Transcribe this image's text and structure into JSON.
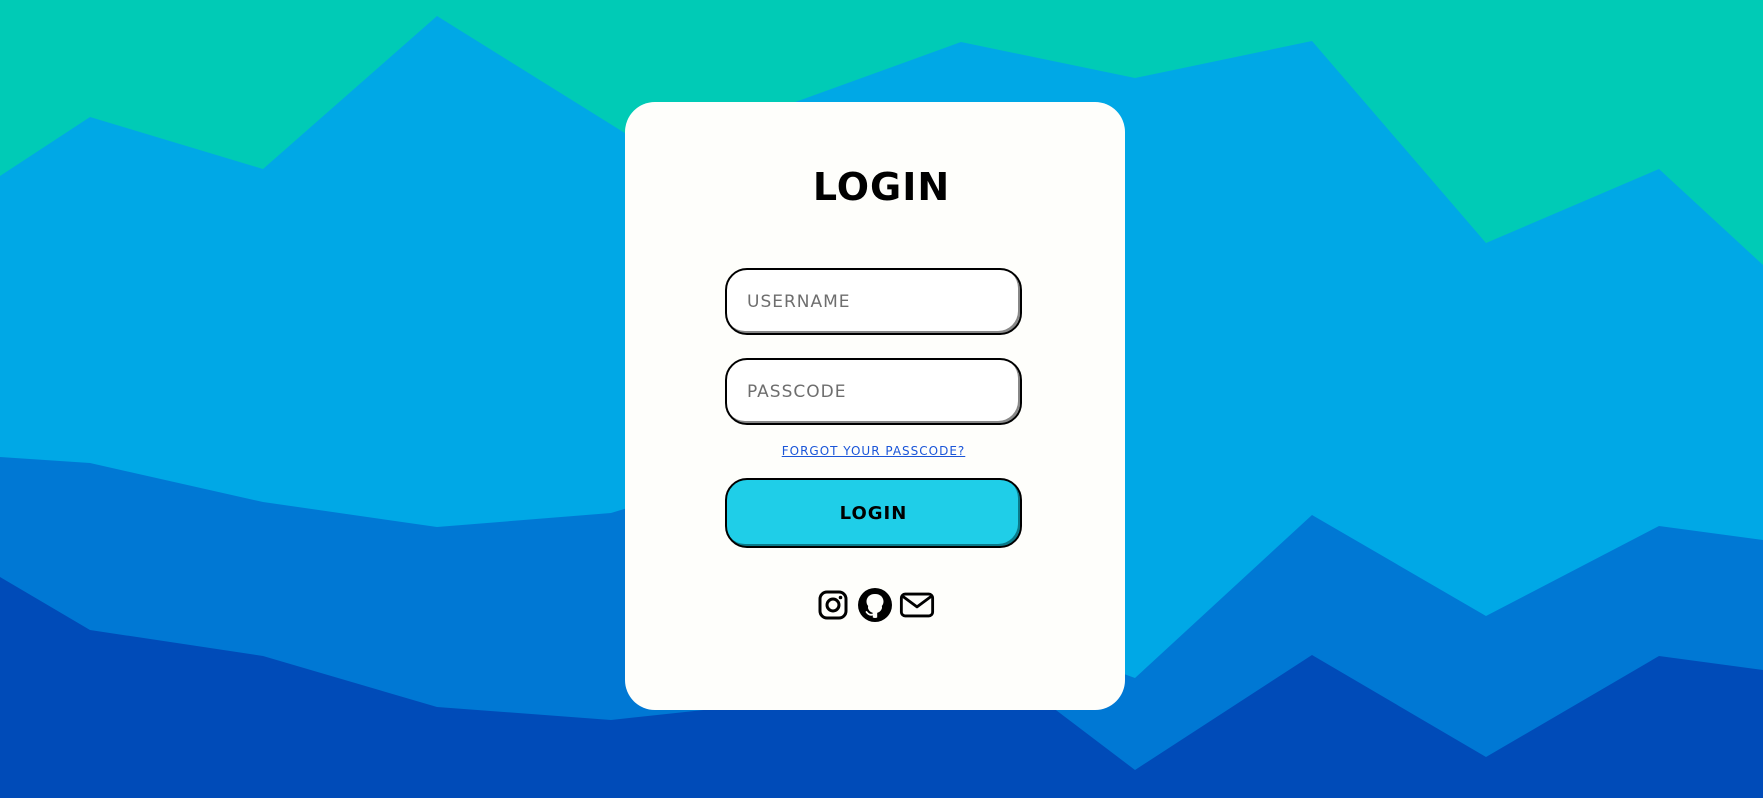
{
  "login": {
    "title": "LOGIN",
    "username_placeholder": "USERNAME",
    "passcode_placeholder": "PASSCODE",
    "forgot_link": "Forgot your passcode?",
    "submit_label": "LOGIN"
  },
  "socials": {
    "items": [
      {
        "icon": "instagram-icon"
      },
      {
        "icon": "github-icon"
      },
      {
        "icon": "mail-icon"
      }
    ]
  },
  "colors": {
    "background_top": "#00cbb6",
    "wave_1": "#00a8e6",
    "wave_2": "#0078d4",
    "wave_3": "#004bb8",
    "card": "#fefefb",
    "button": "#1fcee8",
    "link": "#1a55d8"
  }
}
